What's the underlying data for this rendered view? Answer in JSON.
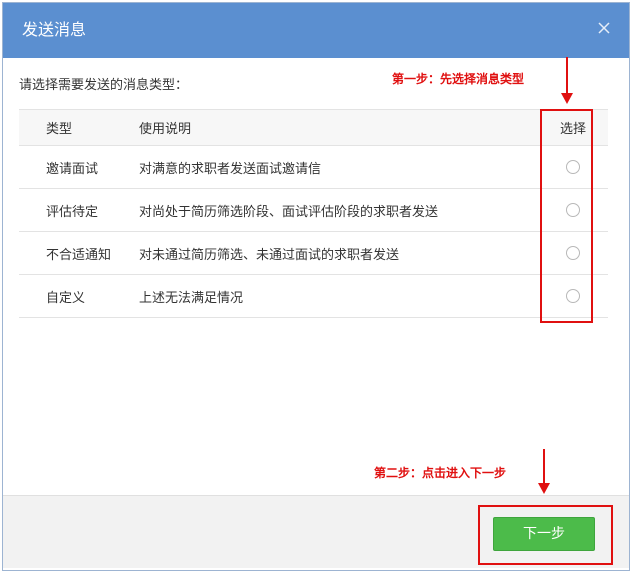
{
  "dialog": {
    "title": "发送消息",
    "close_icon": "close-icon"
  },
  "prompt": "请选择需要发送的消息类型：",
  "annotations": {
    "step1": "第一步：先选择消息类型",
    "step2": "第二步：点击进入下一步",
    "color": "#e01010"
  },
  "table": {
    "headers": {
      "type": "类型",
      "description": "使用说明",
      "select": "选择"
    },
    "rows": [
      {
        "type": "邀请面试",
        "description": "对满意的求职者发送面试邀请信",
        "selected": false
      },
      {
        "type": "评估待定",
        "description": "对尚处于简历筛选阶段、面试评估阶段的求职者发送",
        "selected": false
      },
      {
        "type": "不合适通知",
        "description": "对未通过简历筛选、未通过面试的求职者发送",
        "selected": false
      },
      {
        "type": "自定义",
        "description": "上述无法满足情况",
        "selected": false
      }
    ]
  },
  "footer": {
    "next_label": "下一步"
  },
  "colors": {
    "titlebar": "#5b8fd0",
    "next_button": "#4cbb4a",
    "highlight": "#e01010"
  }
}
